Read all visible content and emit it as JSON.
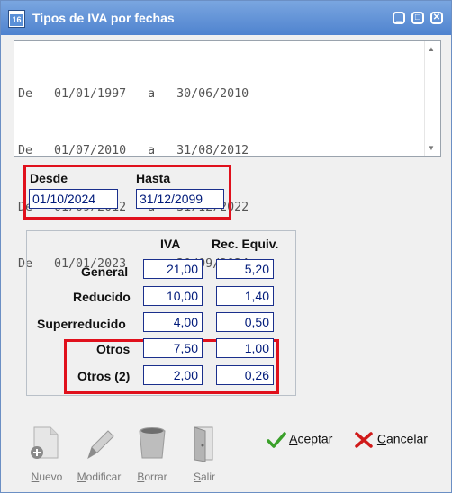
{
  "window": {
    "title": "Tipos de IVA por fechas",
    "icon_text": "16"
  },
  "date_ranges": [
    {
      "from_word": "De",
      "from": "01/01/1997",
      "to_word": "a",
      "to": "30/06/2010"
    },
    {
      "from_word": "De",
      "from": "01/07/2010",
      "to_word": "a",
      "to": "31/08/2012"
    },
    {
      "from_word": "De",
      "from": "01/09/2012",
      "to_word": "a",
      "to": "31/12/2022"
    },
    {
      "from_word": "De",
      "from": "01/01/2023",
      "to_word": "a",
      "to": "30/09/2024"
    }
  ],
  "range_text": [
    "De   01/01/1997   a   30/06/2010",
    "De   01/07/2010   a   31/08/2012",
    "De   01/09/2012   a   31/12/2022",
    "De   01/01/2023   a   30/09/2024"
  ],
  "desde": {
    "label": "Desde",
    "value": "01/10/2024"
  },
  "hasta": {
    "label": "Hasta",
    "value": "31/12/2099"
  },
  "table": {
    "col_iva": "IVA",
    "col_rec": "Rec. Equiv.",
    "rows": [
      {
        "label": "General",
        "iva": "21,00",
        "rec": "5,20"
      },
      {
        "label": "Reducido",
        "iva": "10,00",
        "rec": "1,40"
      },
      {
        "label": "Superreducido",
        "iva": "4,00",
        "rec": "0,50"
      },
      {
        "label": "Otros",
        "iva": "7,50",
        "rec": "1,00"
      },
      {
        "label": "Otros (2)",
        "iva": "2,00",
        "rec": "0,26"
      }
    ]
  },
  "toolbar": {
    "nuevo": {
      "key": "N",
      "rest": "uevo"
    },
    "modificar": {
      "key": "M",
      "rest": "odificar"
    },
    "borrar": {
      "key": "B",
      "rest": "orrar"
    },
    "salir": {
      "key": "S",
      "rest": "alir"
    }
  },
  "actions": {
    "aceptar": {
      "key": "A",
      "rest": "ceptar"
    },
    "cancelar": {
      "key": "C",
      "rest": "ancelar"
    }
  },
  "colors": {
    "highlight_border": "#e0101c",
    "field_border": "#1a2f8c",
    "title_bar": "#5a8fd6"
  }
}
